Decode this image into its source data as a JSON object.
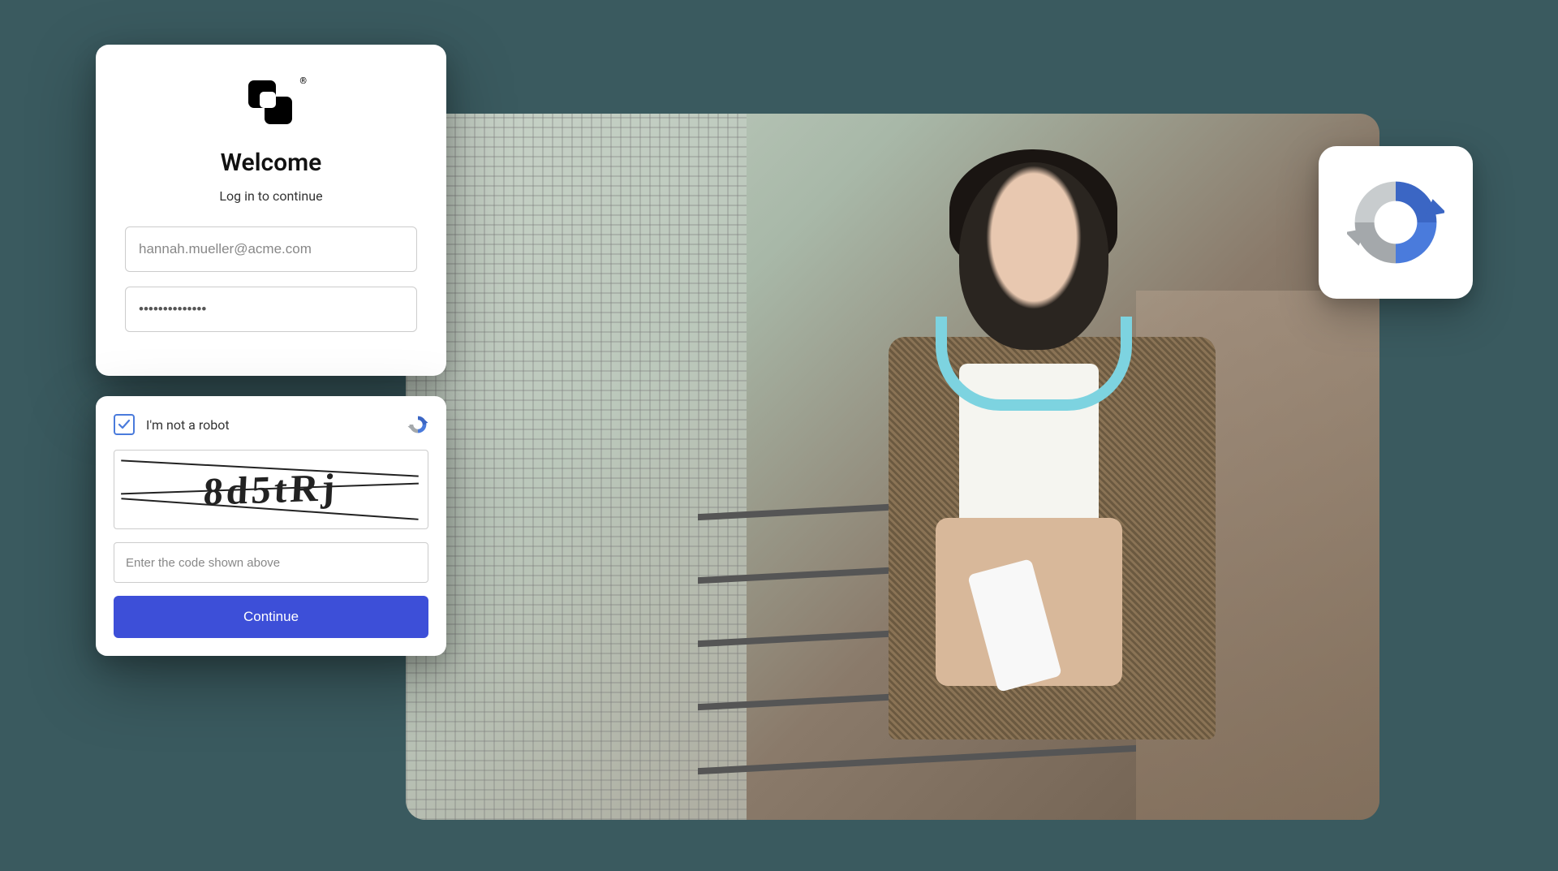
{
  "login": {
    "title": "Welcome",
    "subtitle": "Log in to continue",
    "email_placeholder": "hannah.mueller@acme.com",
    "password_value": "••••••••••••••"
  },
  "captcha": {
    "checkbox_label": "I'm not a robot",
    "captcha_code": "8d5tRj",
    "code_input_placeholder": "Enter the code shown above",
    "continue_label": "Continue",
    "checked": true
  },
  "colors": {
    "primary_button": "#3d4fd8",
    "checkbox_border": "#4a7bdc",
    "recaptcha_blue": "#3b66c4",
    "recaptcha_grey": "#a4a8ab"
  },
  "icons": {
    "logo": "brand-squares",
    "recaptcha": "recaptcha-swirl"
  }
}
